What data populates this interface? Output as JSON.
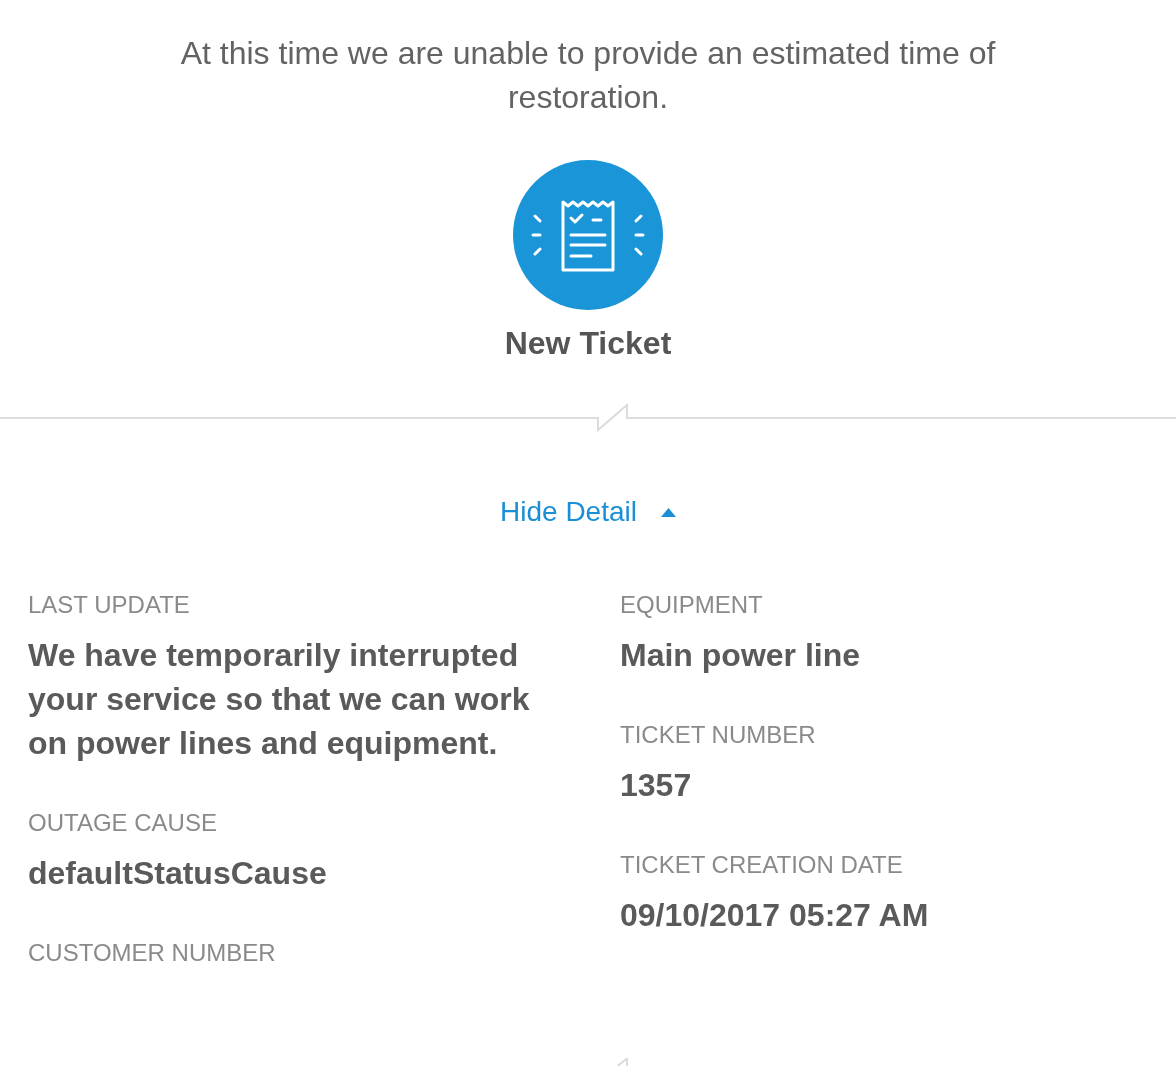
{
  "message": "At this time we are unable to provide an estimated time of restoration.",
  "status": {
    "label": "New Ticket"
  },
  "detail_toggle": {
    "label": "Hide Detail",
    "expanded": true
  },
  "details": {
    "columns": [
      {
        "fields": [
          {
            "label": "LAST UPDATE",
            "value": "We have temporarily interrupted your service so that we can work on power lines and equipment."
          },
          {
            "label": "OUTAGE CAUSE",
            "value": "defaultStatusCause"
          },
          {
            "label": "CUSTOMER NUMBER"
          }
        ]
      },
      {
        "fields": [
          {
            "label": "EQUIPMENT",
            "value": "Main power line"
          },
          {
            "label": "TICKET NUMBER",
            "value": "1357"
          },
          {
            "label": "TICKET CREATION DATE",
            "value": "09/10/2017 05:27 AM"
          }
        ]
      }
    ]
  }
}
